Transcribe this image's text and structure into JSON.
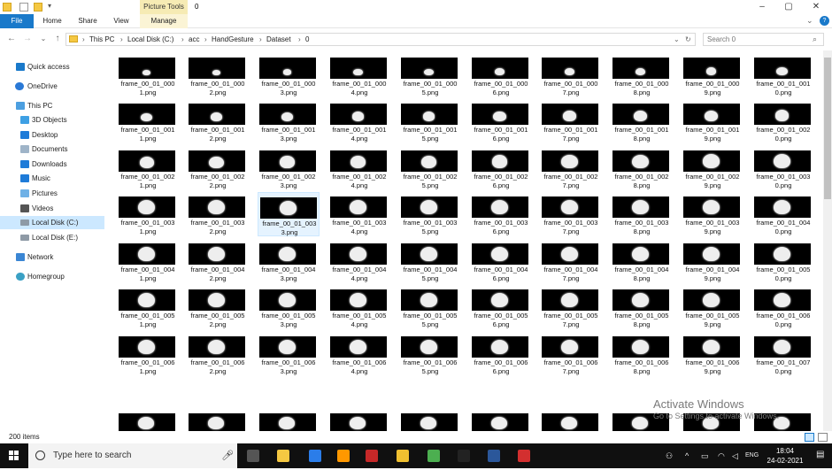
{
  "window": {
    "title": "0",
    "context_tab": "Picture Tools"
  },
  "ribbon": {
    "tabs": [
      "File",
      "Home",
      "Share",
      "View",
      "Manage"
    ]
  },
  "address": {
    "crumbs": [
      "This PC",
      "Local Disk (C:)",
      "acc",
      "HandGesture",
      "Dataset",
      "0"
    ]
  },
  "search": {
    "placeholder": "Search 0"
  },
  "sidebar": {
    "items": [
      {
        "label": "Quick access",
        "icon": "star-icon"
      },
      {
        "label": "OneDrive",
        "icon": "cloud-icon"
      },
      {
        "label": "This PC",
        "icon": "computer-icon"
      },
      {
        "label": "3D Objects",
        "icon": "cube-icon"
      },
      {
        "label": "Desktop",
        "icon": "desktop-icon"
      },
      {
        "label": "Documents",
        "icon": "document-icon"
      },
      {
        "label": "Downloads",
        "icon": "download-icon"
      },
      {
        "label": "Music",
        "icon": "music-icon"
      },
      {
        "label": "Pictures",
        "icon": "pictures-icon"
      },
      {
        "label": "Videos",
        "icon": "video-icon"
      },
      {
        "label": "Local Disk (C:)",
        "icon": "drive-icon"
      },
      {
        "label": "Local Disk (E:)",
        "icon": "drive-icon"
      },
      {
        "label": "Network",
        "icon": "network-icon"
      },
      {
        "label": "Homegroup",
        "icon": "homegroup-icon"
      }
    ]
  },
  "files": [
    "frame_00_01_0001.png",
    "frame_00_01_0002.png",
    "frame_00_01_0003.png",
    "frame_00_01_0004.png",
    "frame_00_01_0005.png",
    "frame_00_01_0006.png",
    "frame_00_01_0007.png",
    "frame_00_01_0008.png",
    "frame_00_01_0009.png",
    "frame_00_01_0010.png",
    "frame_00_01_0011.png",
    "frame_00_01_0012.png",
    "frame_00_01_0013.png",
    "frame_00_01_0014.png",
    "frame_00_01_0015.png",
    "frame_00_01_0016.png",
    "frame_00_01_0017.png",
    "frame_00_01_0018.png",
    "frame_00_01_0019.png",
    "frame_00_01_0020.png",
    "frame_00_01_0021.png",
    "frame_00_01_0022.png",
    "frame_00_01_0023.png",
    "frame_00_01_0024.png",
    "frame_00_01_0025.png",
    "frame_00_01_0026.png",
    "frame_00_01_0027.png",
    "frame_00_01_0028.png",
    "frame_00_01_0029.png",
    "frame_00_01_0030.png",
    "frame_00_01_0031.png",
    "frame_00_01_0032.png",
    "frame_00_01_0033.png",
    "frame_00_01_0034.png",
    "frame_00_01_0035.png",
    "frame_00_01_0036.png",
    "frame_00_01_0037.png",
    "frame_00_01_0038.png",
    "frame_00_01_0039.png",
    "frame_00_01_0040.png",
    "frame_00_01_0041.png",
    "frame_00_01_0042.png",
    "frame_00_01_0043.png",
    "frame_00_01_0044.png",
    "frame_00_01_0045.png",
    "frame_00_01_0046.png",
    "frame_00_01_0047.png",
    "frame_00_01_0048.png",
    "frame_00_01_0049.png",
    "frame_00_01_0050.png",
    "frame_00_01_0051.png",
    "frame_00_01_0052.png",
    "frame_00_01_0053.png",
    "frame_00_01_0054.png",
    "frame_00_01_0055.png",
    "frame_00_01_0056.png",
    "frame_00_01_0057.png",
    "frame_00_01_0058.png",
    "frame_00_01_0059.png",
    "frame_00_01_0060.png",
    "frame_00_01_0061.png",
    "frame_00_01_0062.png",
    "frame_00_01_0063.png",
    "frame_00_01_0064.png",
    "frame_00_01_0065.png",
    "frame_00_01_0066.png",
    "frame_00_01_0067.png",
    "frame_00_01_0068.png",
    "frame_00_01_0069.png",
    "frame_00_01_0070.png"
  ],
  "selected_file": "frame_00_01_0033.png",
  "status": {
    "items": "200 items"
  },
  "watermark": {
    "line1": "Activate Windows",
    "line2": "Go to Settings to activate Windows."
  },
  "taskbar": {
    "search_placeholder": "Type here to search",
    "apps": [
      "task-view-icon",
      "security-icon",
      "edge-icon",
      "sublime-icon",
      "cmd-icon",
      "file-explorer-icon",
      "chrome-icon",
      "vscode-icon",
      "word-icon",
      "acrobat-icon"
    ],
    "time": "18:04",
    "date": "24-02-2021",
    "lang": "ENG"
  },
  "colors": {
    "accent": "#1979ca",
    "selection": "#cce8ff",
    "taskbar": "#101010",
    "picture_tools": "#f6ebb4"
  }
}
